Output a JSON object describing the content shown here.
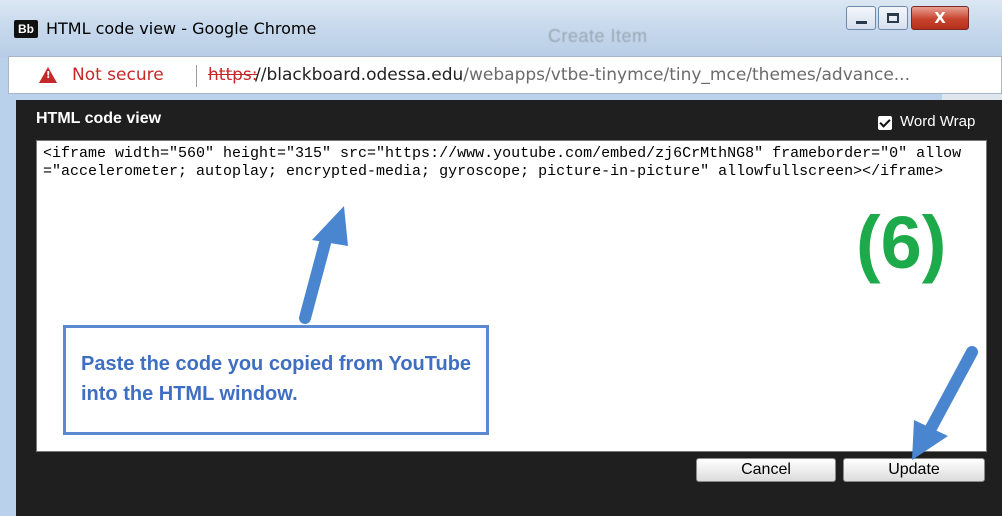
{
  "window": {
    "app_logo": "Bb",
    "title": "HTML code view - Google Chrome",
    "background_title": "Create Item",
    "close_label": "X"
  },
  "address_bar": {
    "security_label": "Not secure",
    "url_scheme": "https:",
    "url_host": "//blackboard.odessa.edu",
    "url_path": "/webapps/vtbe-tinymce/tiny_mce/themes/advance..."
  },
  "dialog": {
    "title": "HTML code view",
    "word_wrap_label": "Word Wrap",
    "word_wrap_checked": true,
    "code_value": "<iframe width=\"560\" height=\"315\" src=\"https://www.youtube.com/embed/zj6CrMthNG8\" frameborder=\"0\" allow=\"accelerometer; autoplay; encrypted-media; gyroscope; picture-in-picture\" allowfullscreen></iframe>",
    "cancel_label": "Cancel",
    "update_label": "Update"
  },
  "annotations": {
    "callout_text": "Paste the code you copied from YouTube into the HTML window.",
    "step_label": "(6)",
    "arrow_color": "#4a86d0",
    "step_color": "#1daa4a"
  }
}
